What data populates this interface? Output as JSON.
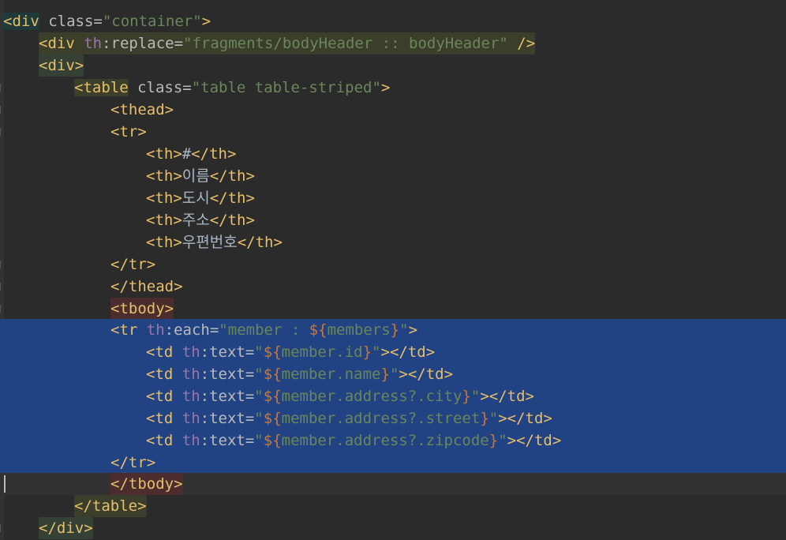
{
  "editor": {
    "language": "HTML (Thymeleaf)",
    "lines": [
      {
        "tag_open": "<div",
        "attr": " class=",
        "value": "\"container\"",
        "close": ">"
      },
      {
        "tag_open": "<div",
        "ns": " th",
        "attr": ":replace=",
        "value": "\"fragments/bodyHeader :: bodyHeader\"",
        "close": " />"
      },
      {
        "tag_open": "<div",
        "close": ">"
      },
      {
        "tag_open": "<table",
        "attr": " class=",
        "value": "\"table table-striped\"",
        "close": ">"
      },
      {
        "tag_open": "<thead",
        "close": ">"
      },
      {
        "tag_open": "<tr",
        "close": ">"
      },
      {
        "tag_open": "<th>",
        "text": "#",
        "close": "</th>"
      },
      {
        "tag_open": "<th>",
        "text": "이름",
        "close": "</th>"
      },
      {
        "tag_open": "<th>",
        "text": "도시",
        "close": "</th>"
      },
      {
        "tag_open": "<th>",
        "text": "주소",
        "close": "</th>"
      },
      {
        "tag_open": "<th>",
        "text": "우편번호",
        "close": "</th>"
      },
      {
        "tag_open": "</tr",
        "close": ">"
      },
      {
        "tag_open": "</thead",
        "close": ">"
      },
      {
        "tag_open": "<tbody",
        "close": ">"
      },
      {
        "tag_open": "<tr",
        "ns": " th",
        "attr": ":each=",
        "q1": "\"",
        "s1": "member : ",
        "e1": "${",
        "s2": "members",
        "e2": "}",
        "q2": "\"",
        "close": ">"
      },
      {
        "tag_open": "<td",
        "ns": " th",
        "attr": ":text=",
        "q1": "\"",
        "e1": "${",
        "s2": "member.id",
        "e2": "}",
        "q2": "\"",
        "close": "></td>"
      },
      {
        "tag_open": "<td",
        "ns": " th",
        "attr": ":text=",
        "q1": "\"",
        "e1": "${",
        "s2": "member.name",
        "e2": "}",
        "q2": "\"",
        "close": "></td>"
      },
      {
        "tag_open": "<td",
        "ns": " th",
        "attr": ":text=",
        "q1": "\"",
        "e1": "${",
        "s2": "member.address?.city",
        "e2": "}",
        "q2": "\"",
        "close": "></td>"
      },
      {
        "tag_open": "<td",
        "ns": " th",
        "attr": ":text=",
        "q1": "\"",
        "e1": "${",
        "s2": "member.address?.street",
        "e2": "}",
        "q2": "\"",
        "close": "></td>"
      },
      {
        "tag_open": "<td",
        "ns": " th",
        "attr": ":text=",
        "q1": "\"",
        "e1": "${",
        "s2": "member.address?.zipcode",
        "e2": "}",
        "q2": "\"",
        "close": "></td>"
      },
      {
        "tag_open": "</tr",
        "close": ">"
      },
      {
        "tag_open": "</tbody",
        "close": ">"
      },
      {
        "tag_open": "</table",
        "close": ">"
      },
      {
        "tag_open": "</div",
        "close": ">"
      }
    ]
  },
  "colors": {
    "background": "#2b2b2b",
    "selection": "#214283",
    "tag": "#e8bf6a",
    "string": "#6a8759",
    "namespace": "#9876aa"
  }
}
